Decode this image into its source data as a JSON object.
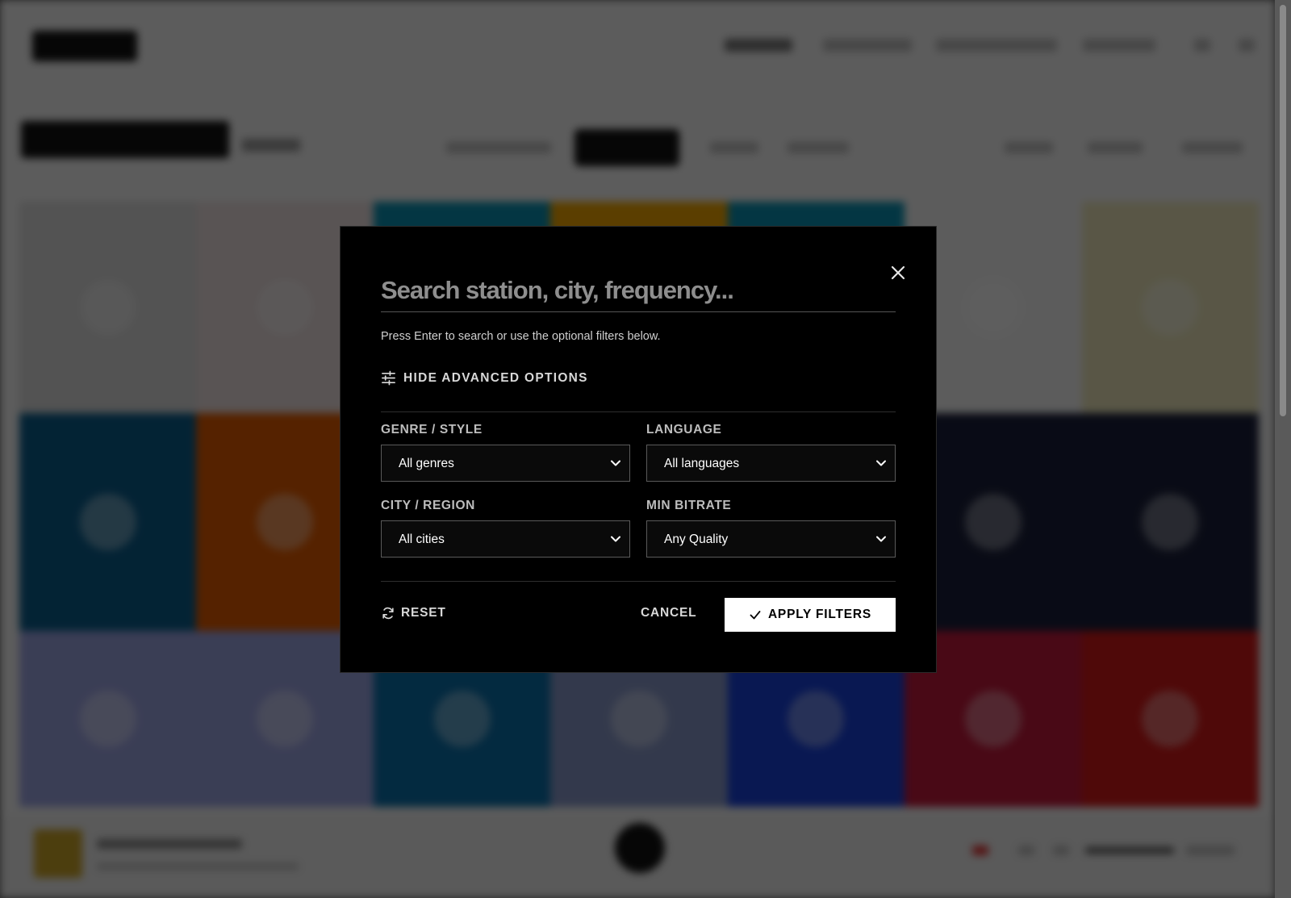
{
  "modal": {
    "search": {
      "placeholder": "Search station, city, frequency...",
      "value": ""
    },
    "hint": "Press Enter to search or use the optional filters below.",
    "advanced_toggle_label": "HIDE ADVANCED OPTIONS",
    "filters": {
      "genre": {
        "label": "GENRE / STYLE",
        "selected": "All genres"
      },
      "language": {
        "label": "LANGUAGE",
        "selected": "All languages"
      },
      "city": {
        "label": "CITY / REGION",
        "selected": "All cities"
      },
      "bitrate": {
        "label": "MIN BITRATE",
        "selected": "Any Quality"
      }
    },
    "actions": {
      "reset_label": "RESET",
      "cancel_label": "CANCEL",
      "apply_label": "APPLY FILTERS"
    }
  },
  "icons": {
    "close": "close-icon",
    "advanced": "sliders-icon",
    "reset": "refresh-icon",
    "apply": "check-icon",
    "select": "chevron-down-icon"
  },
  "colors": {
    "modal_bg": "#000000",
    "overlay": "rgba(0,0,0,0.62)",
    "apply_bg": "#ffffff",
    "placeholder": "#8e8e8e"
  },
  "background_tiles": [
    "#d9d9d9",
    "#e9dcdc",
    "#0a8fb0",
    "#f0a400",
    "#0a8fb0",
    "#f2f2f2",
    "#e9e3b8",
    "#0a5c8a",
    "#e05a00",
    "#1f2b5a",
    "#1f2b5a",
    "#1f2b5a",
    "#1a1f3a",
    "#1a1f3a",
    "#9aa2e0",
    "#9aa2e0",
    "#0a6ea8",
    "#8797c8",
    "#1840d8",
    "#c0183a",
    "#d01818"
  ]
}
